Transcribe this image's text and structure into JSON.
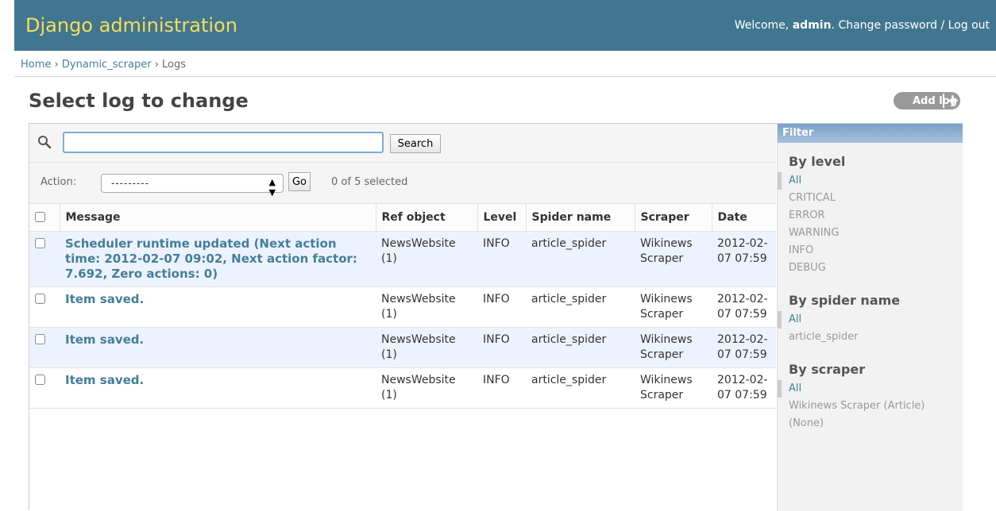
{
  "header": {
    "title": "Django administration",
    "welcome": "Welcome,",
    "username": "admin",
    "change_password": "Change password",
    "separator": "/",
    "logout": "Log out"
  },
  "breadcrumbs": {
    "home": "Home",
    "app": "Dynamic_scraper",
    "current": "Logs",
    "sep": "›"
  },
  "page": {
    "title": "Select log to change",
    "add_button": "Add log",
    "add_icon": "+"
  },
  "search": {
    "value": "",
    "button": "Search"
  },
  "actions": {
    "label": "Action:",
    "selected_option": "---------",
    "go": "Go",
    "selection_counter": "0 of 5 selected"
  },
  "table": {
    "columns": [
      "Message",
      "Ref object",
      "Level",
      "Spider name",
      "Scraper",
      "Date"
    ],
    "rows": [
      {
        "message": "Scheduler runtime updated (Next action time: 2012-02-07 09:02, Next action factor: 7.692, Zero actions: 0)",
        "ref_object": "NewsWebsite (1)",
        "level": "INFO",
        "spider_name": "article_spider",
        "scraper": "Wikinews Scraper",
        "date": "2012-02-07 07:59"
      },
      {
        "message": "Item saved.",
        "ref_object": "NewsWebsite (1)",
        "level": "INFO",
        "spider_name": "article_spider",
        "scraper": "Wikinews Scraper",
        "date": "2012-02-07 07:59"
      },
      {
        "message": "Item saved.",
        "ref_object": "NewsWebsite (1)",
        "level": "INFO",
        "spider_name": "article_spider",
        "scraper": "Wikinews Scraper",
        "date": "2012-02-07 07:59"
      },
      {
        "message": "Item saved.",
        "ref_object": "NewsWebsite (1)",
        "level": "INFO",
        "spider_name": "article_spider",
        "scraper": "Wikinews Scraper",
        "date": "2012-02-07 07:59"
      }
    ]
  },
  "filter": {
    "title": "Filter",
    "groups": [
      {
        "heading": "By level",
        "items": [
          "All",
          "CRITICAL",
          "ERROR",
          "WARNING",
          "INFO",
          "DEBUG"
        ],
        "selected": "All"
      },
      {
        "heading": "By spider name",
        "items": [
          "All",
          "article_spider"
        ],
        "selected": "All"
      },
      {
        "heading": "By scraper",
        "items": [
          "All",
          "Wikinews Scraper (Article)",
          "(None)"
        ],
        "selected": "All"
      }
    ]
  },
  "colors": {
    "header_bg": "#417690",
    "header_title": "#f5dd5d",
    "link": "#447e9b",
    "row_alt": "#edf3fe"
  },
  "icons": [
    "search-icon",
    "add-icon",
    "select-caret-icon"
  ]
}
